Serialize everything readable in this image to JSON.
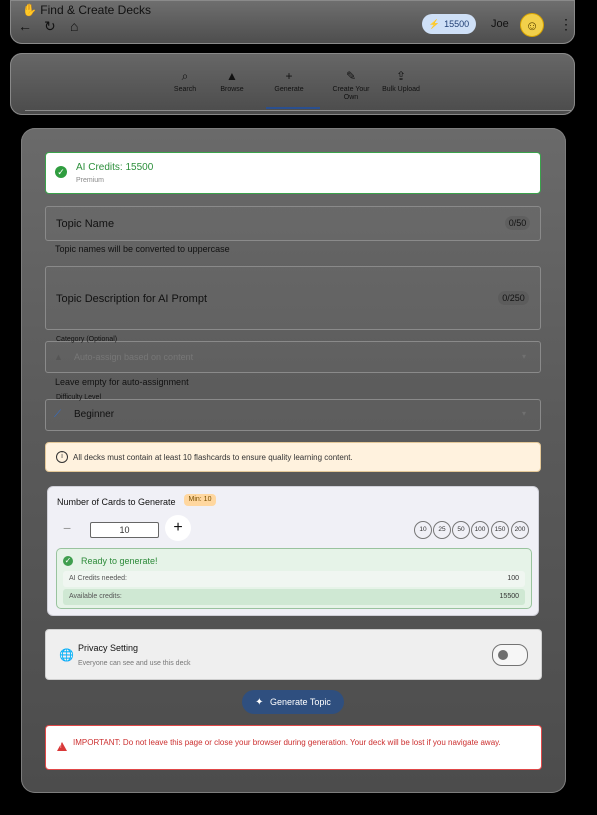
{
  "app": {
    "title": "Find & Create Decks",
    "credits_badge": "15500",
    "user_name": "Joe",
    "icons": {
      "back": "arrow-left-icon",
      "refresh": "refresh-icon",
      "home": "home-icon",
      "avatar": "avatar-icon",
      "more": "more-vert-icon"
    }
  },
  "tabs": [
    {
      "label": "Search",
      "icon": "search-icon"
    },
    {
      "label": "Browse",
      "icon": "browse-icon"
    },
    {
      "label": "Generate",
      "icon": "plus-icon"
    },
    {
      "label": "Create Your Own",
      "icon": "pencil-icon"
    },
    {
      "label": "Bulk Upload",
      "icon": "upload-icon"
    }
  ],
  "credits_card": {
    "title": "AI Credits: 15500",
    "subtitle": "Premium"
  },
  "topic_name": {
    "label": "Topic Name",
    "counter": "0/50",
    "helper": "Topic names will be converted to uppercase"
  },
  "topic_description": {
    "label": "Topic Description for AI Prompt",
    "counter": "0/250"
  },
  "category": {
    "legend": "Category (Optional)",
    "value": "Auto-assign based on content",
    "helper": "Leave empty for auto-assignment"
  },
  "difficulty": {
    "legend": "Difficulty Level",
    "value": "Beginner"
  },
  "info": {
    "text": "All decks must contain at least 10 flashcards to ensure quality learning content."
  },
  "cards": {
    "title": "Number of Cards to Generate",
    "min_badge": "Min: 10",
    "count_value": "10",
    "presets": [
      "10",
      "25",
      "50",
      "100",
      "150",
      "200"
    ],
    "ready": {
      "title": "Ready to generate!",
      "needed_label": "AI Credits needed:",
      "needed_value": "100",
      "available_label": "Available credits:",
      "available_value": "15500"
    }
  },
  "privacy": {
    "title": "Privacy Setting",
    "subtitle": "Everyone can see and use this deck",
    "toggle_on": false
  },
  "actions": {
    "generate_label": "Generate Topic"
  },
  "warning": {
    "text": "IMPORTANT: Do not leave this page or close your browser during generation. Your deck will be lost if you navigate away."
  },
  "colors": {
    "success": "#3aa24b",
    "primary": "#2f4f7f",
    "warning": "#cc2f2f",
    "info_bg": "#fff2de"
  }
}
